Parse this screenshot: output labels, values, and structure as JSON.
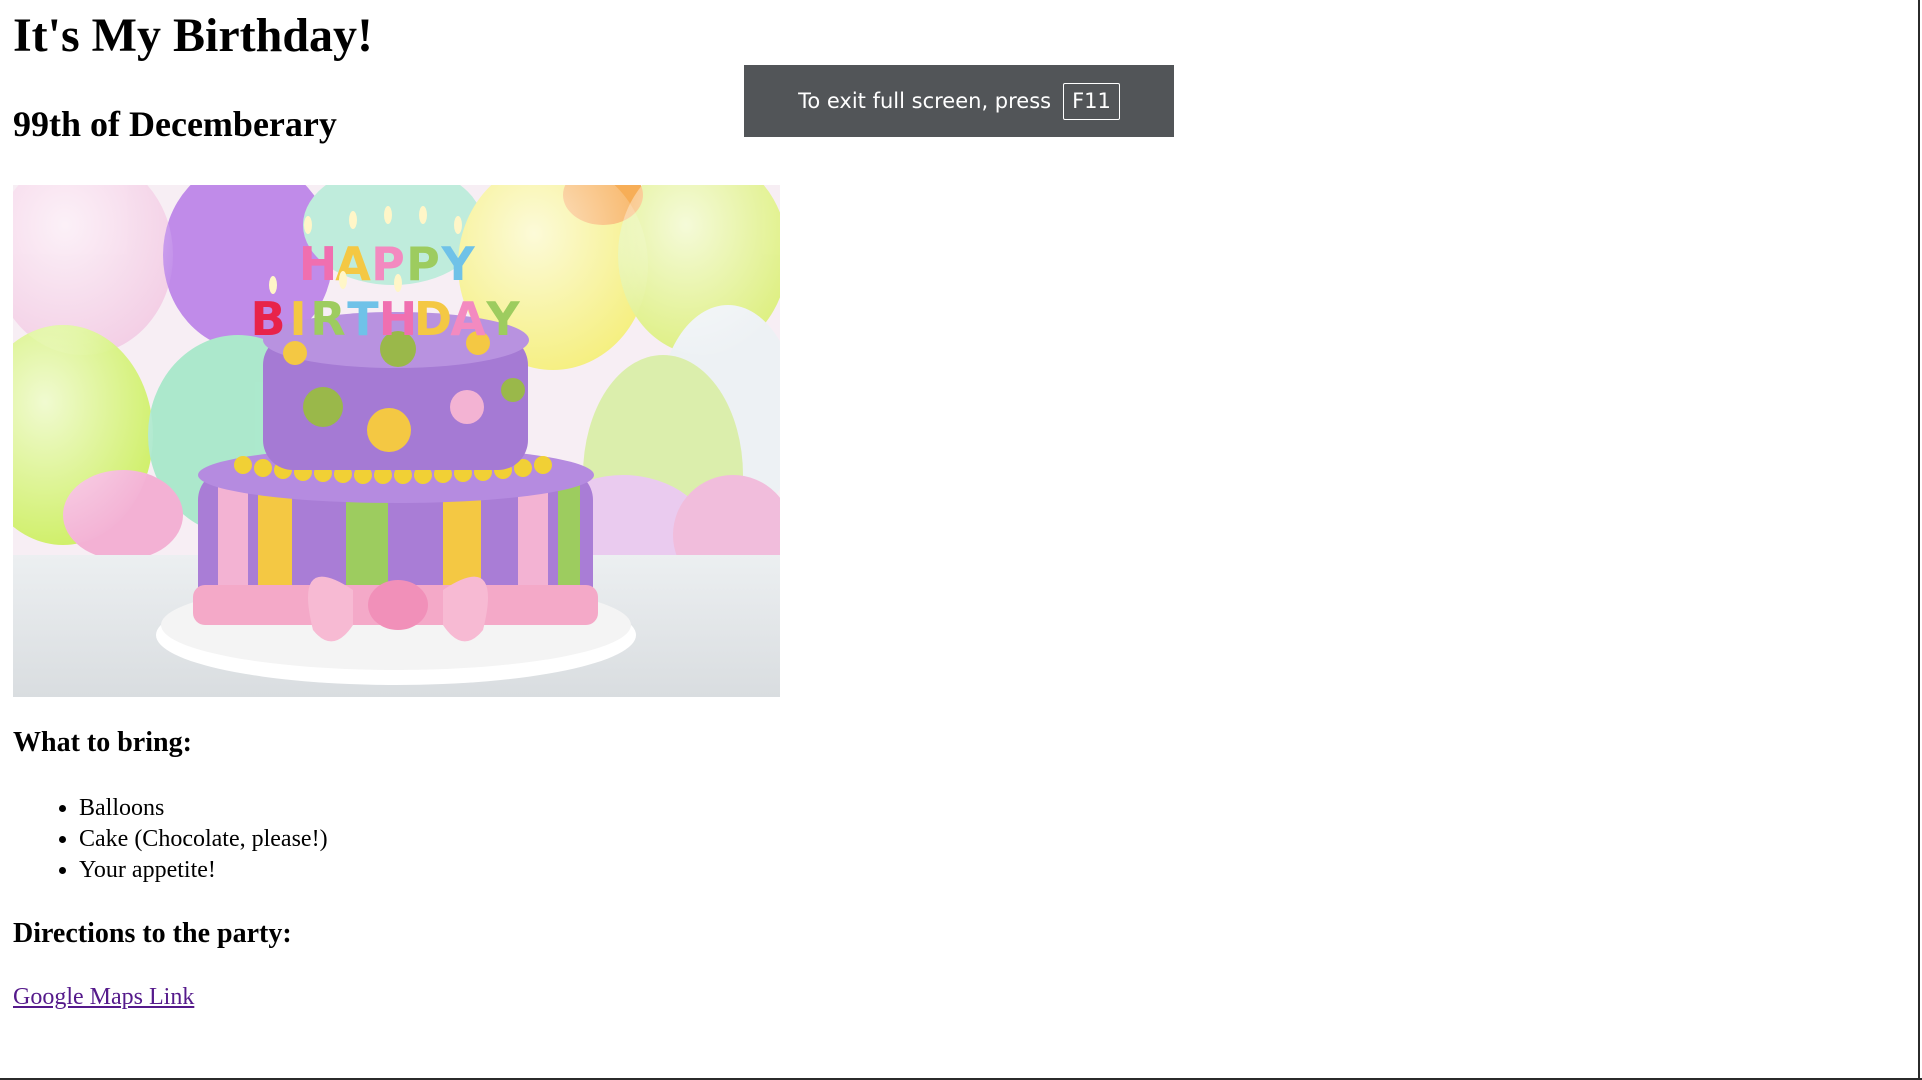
{
  "page": {
    "title": "It's My Birthday!",
    "date": "99th of Decemberary",
    "image": {
      "banner_letters_top": "HAPPY",
      "banner_letters_bottom": "BIRTHDAY"
    },
    "bring": {
      "heading": "What to bring:",
      "items": [
        "Balloons",
        "Cake (Chocolate, please!)",
        "Your appetite!"
      ]
    },
    "directions": {
      "heading": "Directions to the party:",
      "link_text": "Google Maps Link"
    }
  },
  "fullscreen_toast": {
    "message": "To exit full screen, press",
    "key": "F11"
  },
  "colors": {
    "link_visited": "#551a8b",
    "toast_bg": "#525558"
  }
}
